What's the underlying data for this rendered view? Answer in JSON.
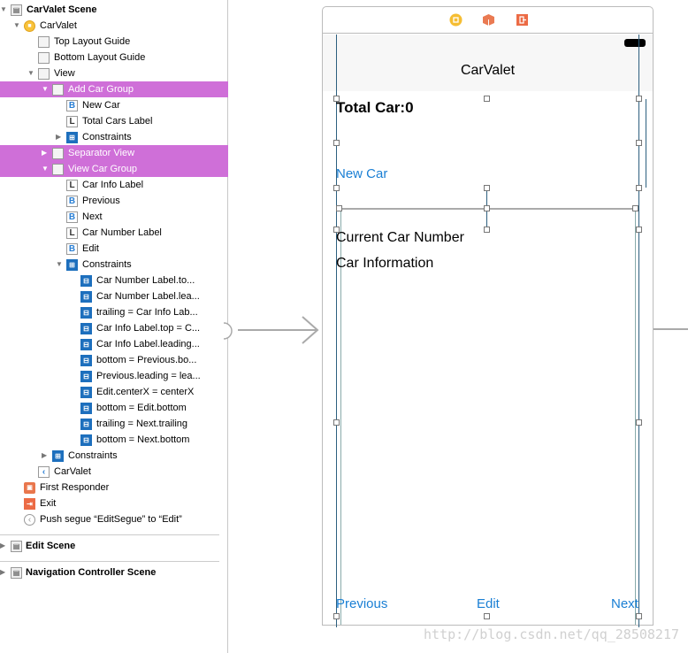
{
  "outline": {
    "rows": [
      {
        "label": "CarValet Scene",
        "icon": "scene-icon",
        "arrow": "down",
        "bold": true
      },
      {
        "label": "CarValet",
        "icon": "view-controller-icon",
        "arrow": "down"
      },
      {
        "label": "Top Layout Guide",
        "icon": "layout-guide-icon"
      },
      {
        "label": "Bottom Layout Guide",
        "icon": "layout-guide-icon"
      },
      {
        "label": "View",
        "icon": "view-icon",
        "arrow": "down"
      },
      {
        "label": "Add Car Group",
        "icon": "view-icon",
        "arrow": "down",
        "selected": true
      },
      {
        "label": "New Car",
        "icon": "button-icon"
      },
      {
        "label": "Total Cars Label",
        "icon": "label-icon"
      },
      {
        "label": "Constraints",
        "icon": "constraints-icon",
        "arrow": "right"
      },
      {
        "label": "Separator View",
        "icon": "view-icon",
        "arrow": "right",
        "selected": true
      },
      {
        "label": "View Car Group",
        "icon": "view-icon",
        "arrow": "down",
        "selected": true
      },
      {
        "label": "Car Info Label",
        "icon": "label-icon"
      },
      {
        "label": "Previous",
        "icon": "button-icon"
      },
      {
        "label": "Next",
        "icon": "button-icon"
      },
      {
        "label": "Car Number Label",
        "icon": "label-icon"
      },
      {
        "label": "Edit",
        "icon": "button-icon"
      },
      {
        "label": "Constraints",
        "icon": "constraints-icon",
        "arrow": "down"
      },
      {
        "label": "Car Number Label.to...",
        "icon": "constraint-icon"
      },
      {
        "label": "Car Number Label.lea...",
        "icon": "constraint-icon"
      },
      {
        "label": "trailing = Car Info Lab...",
        "icon": "constraint-icon"
      },
      {
        "label": "Car Info Label.top = C...",
        "icon": "constraint-icon"
      },
      {
        "label": "Car Info Label.leading...",
        "icon": "constraint-icon"
      },
      {
        "label": "bottom = Previous.bo...",
        "icon": "constraint-icon"
      },
      {
        "label": "Previous.leading = lea...",
        "icon": "constraint-icon"
      },
      {
        "label": "Edit.centerX = centerX",
        "icon": "constraint-icon"
      },
      {
        "label": "bottom = Edit.bottom",
        "icon": "constraint-icon"
      },
      {
        "label": "trailing = Next.trailing",
        "icon": "constraint-icon"
      },
      {
        "label": "bottom = Next.bottom",
        "icon": "constraint-icon"
      },
      {
        "label": "Constraints",
        "icon": "constraints-icon",
        "arrow": "right"
      },
      {
        "label": "CarValet",
        "icon": "navigation-item-icon"
      },
      {
        "label": "First Responder",
        "icon": "first-responder-icon"
      },
      {
        "label": "Exit",
        "icon": "exit-icon"
      },
      {
        "label": "Push segue “EditSegue” to “Edit”",
        "icon": "segue-icon"
      }
    ],
    "scenes": [
      {
        "label": "Edit Scene"
      },
      {
        "label": "Navigation Controller Scene"
      }
    ]
  },
  "canvas": {
    "nav_title": "CarValet",
    "total_label": "Total Car:0",
    "new_car": "New Car",
    "current_car": "Current Car Number",
    "car_info": "Car Information",
    "previous": "Previous",
    "edit": "Edit",
    "next": "Next"
  },
  "watermark": "http://blog.csdn.net/qq_28508217",
  "colors": {
    "selection": "#cf6fd8",
    "button_text": "#1a7fd4"
  }
}
